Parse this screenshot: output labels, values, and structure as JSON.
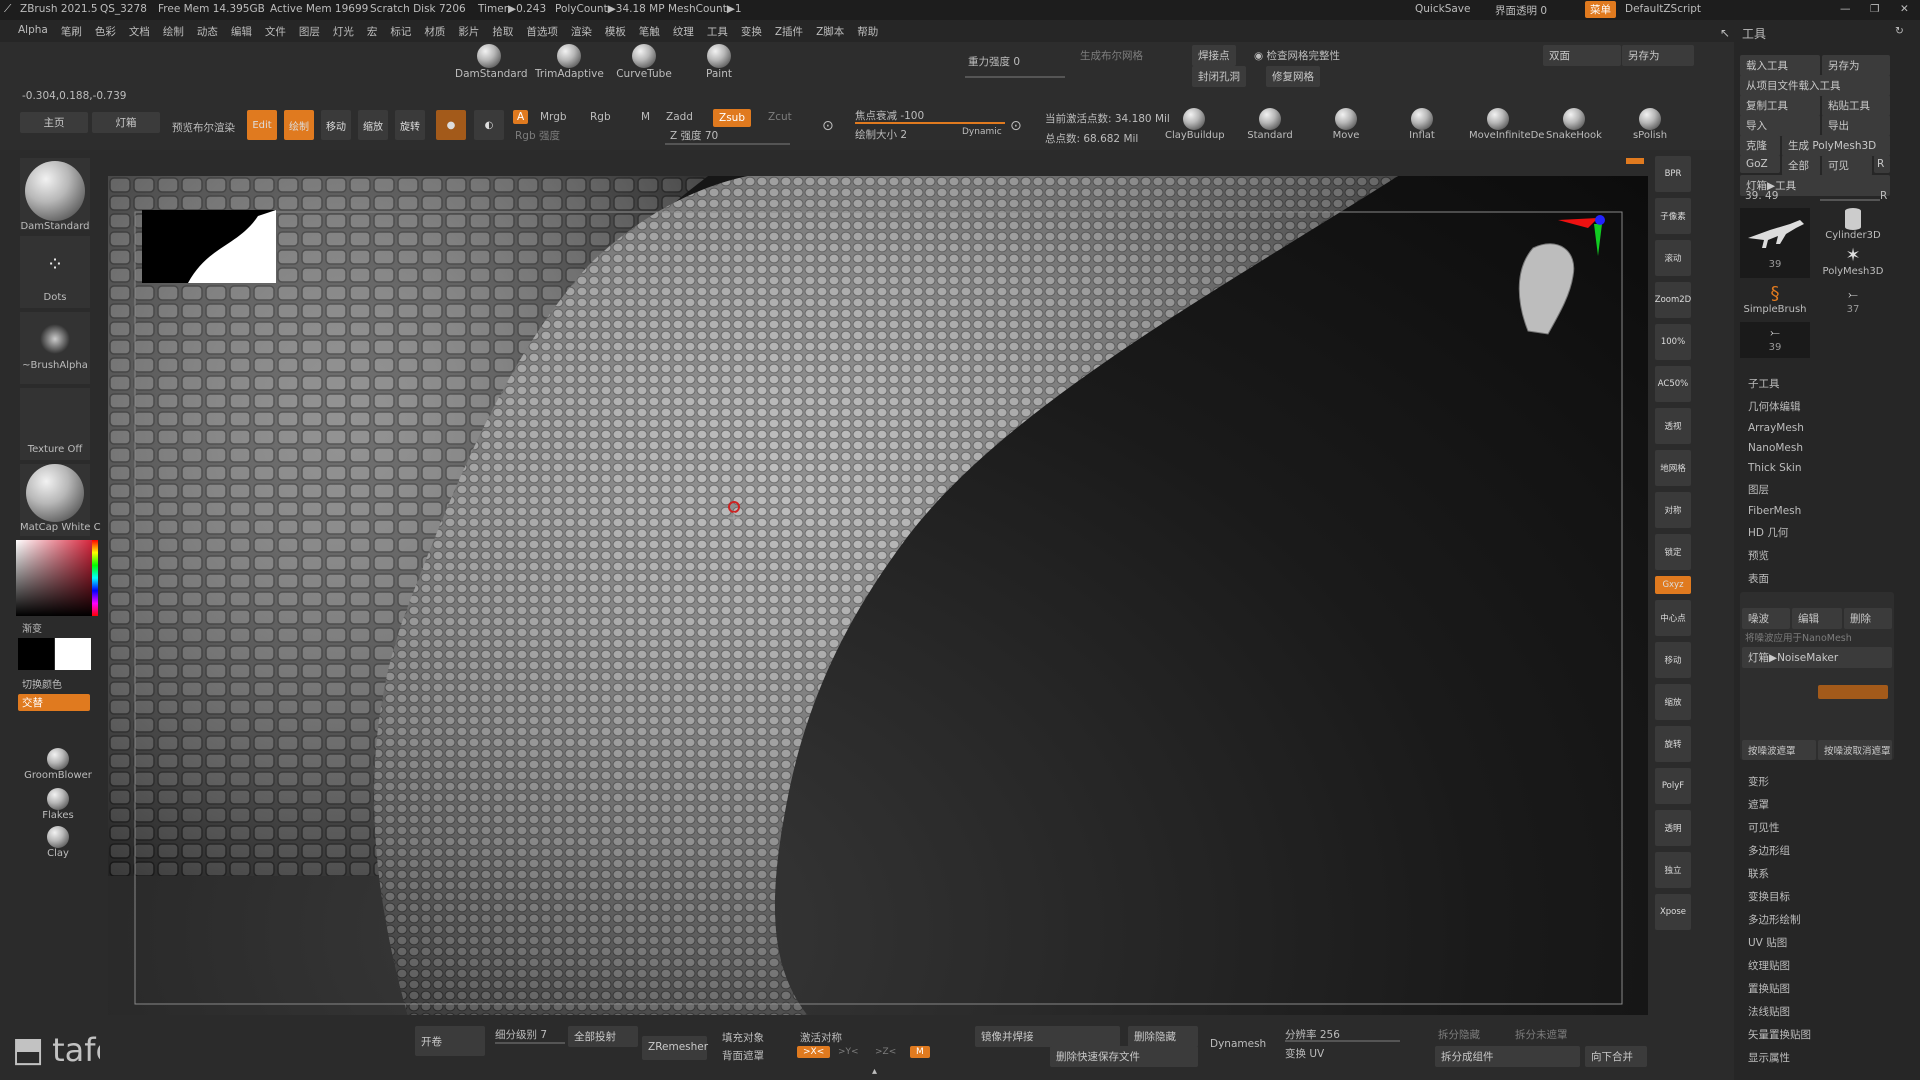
{
  "titlebar": {
    "app": "ZBrush 2021.5",
    "project": "QS_3278",
    "free_mem": "Free Mem 14.395GB",
    "active_mem": "Active Mem 19699",
    "scratch": "Scratch Disk 7206",
    "timer": "Timer▶0.243",
    "polycount": "PolyCount▶34.18 MP",
    "meshcount": "MeshCount▶1",
    "quicksave": "QuickSave",
    "transparency": "界面透明 0",
    "menu": "菜单",
    "script": "DefaultZScript"
  },
  "menubar": {
    "items": [
      "Alpha",
      "笔刷",
      "色彩",
      "文档",
      "绘制",
      "动态",
      "编辑",
      "文件",
      "图层",
      "灯光",
      "宏",
      "标记",
      "材质",
      "影片",
      "拾取",
      "首选项",
      "渲染",
      "模板",
      "笔触",
      "纹理",
      "工具",
      "变换",
      "Z插件",
      "Z脚本",
      "帮助"
    ]
  },
  "top": {
    "coords": "-0.304,0.188,-0.739",
    "home": "主页",
    "lightbox": "灯箱",
    "bpr": "预览布尔渲染",
    "brushes": [
      "DamStandard",
      "TrimAdaptive",
      "CurveTube",
      "Paint"
    ],
    "gravity": "重力强度 0",
    "weld": "焊接点",
    "check_mesh": "检查网格完整性",
    "close_holes": "封闭孔洞",
    "fix_mesh": "修复网格",
    "double": "双面",
    "save_as": "另存为",
    "gen_mesh": "生成布尔网格",
    "edit": "Edit",
    "draw": "绘制",
    "move": "移动",
    "scale": "缩放",
    "rotate": "旋转",
    "a_label": "A",
    "mrgb": "Mrgb",
    "rgb": "Rgb",
    "m": "M",
    "zadd": "Zadd",
    "zsub": "Zsub",
    "zcut": "Zcut",
    "rgb_intensity": "Rgb 强度",
    "z_intensity": "Z 强度 70",
    "focal": "焦点衰减 -100",
    "draw_size": "绘制大小 2",
    "dynamic": "Dynamic",
    "active_points": "当前激活点数: 34.180 Mil",
    "total_points": "总点数: 68.682 Mil",
    "brushes_right": [
      "ClayBuildup",
      "Standard",
      "Move",
      "Inflat",
      "MoveInfiniteDe",
      "SnakeHook",
      "sPolish"
    ]
  },
  "left": {
    "brush": "DamStandard",
    "stroke": "Dots",
    "alpha": "~BrushAlpha",
    "texture": "Texture Off",
    "material": "MatCap White C",
    "gradient": "渐变",
    "switch_color": "切换颜色",
    "alternate": "交替",
    "extra_brushes": [
      "GroomBlower",
      "Flakes",
      "Clay"
    ]
  },
  "shelf": [
    "BPR",
    "子像素",
    "滚动",
    "Zoom2D",
    "100%",
    "AC50%",
    "透视",
    "地网格",
    "对称",
    "锁定",
    "Gxyz",
    "中心点",
    "移动",
    "缩放",
    "旋转",
    "PolyF",
    "透明",
    "独立",
    "Xpose"
  ],
  "rightpanel": {
    "title": "工具",
    "load_tool": "载入工具",
    "save_as": "另存为",
    "load_from_project": "从项目文件载入工具",
    "copy_tool": "复制工具",
    "paste_tool": "粘贴工具",
    "import": "导入",
    "export": "导出",
    "clone": "克隆",
    "make_polymesh": "生成 PolyMesh3D",
    "goz": "GoZ",
    "all": "全部",
    "visible": "可见",
    "r": "R",
    "lightbox_tool": "灯箱▶工具",
    "tool_value": "39. 49",
    "thumbs": [
      {
        "label": "",
        "count": "39"
      },
      {
        "label": "Cylinder3D",
        "count": ""
      },
      {
        "label": "",
        "count": ""
      },
      {
        "label": "PolyMesh3D",
        "count": ""
      },
      {
        "label": "SimpleBrush",
        "count": ""
      },
      {
        "label": "",
        "count": "37"
      },
      {
        "label": "",
        "count": "39"
      }
    ],
    "sections": [
      "子工具",
      "几何体编辑",
      "ArrayMesh",
      "NanoMesh",
      "Thick Skin",
      "图层",
      "FiberMesh",
      "HD 几何",
      "预览",
      "表面"
    ],
    "surface": {
      "noise": "噪波",
      "edit": "编辑",
      "delete": "删除",
      "apply_nano": "将噪波应用于NanoMesh",
      "noisemaker": "灯箱▶NoiseMaker",
      "mask_by": "按噪波遮罩",
      "unmask_by": "按噪波取消遮罩"
    },
    "sections2": [
      "变形",
      "遮罩",
      "可见性",
      "多边形组",
      "联系",
      "变换目标",
      "多边形绘制",
      "UV 贴图",
      "纹理贴图",
      "置换贴图",
      "法线贴图",
      "矢量置换贴图",
      "显示属性"
    ]
  },
  "bottom": {
    "rollout": "开卷",
    "sdiv": "细分级别 7",
    "project_all": "全部投射",
    "zremesher": "ZRemesher",
    "fill_object": "填充对象",
    "activate_sym": "激活对称",
    "back_mask": "背面遮罩",
    "mirror_weld": "镜像并焊接",
    "del_hidden": "删除隐藏",
    "del_quicksave": "删除快速保存文件",
    "dynamesh": "Dynamesh",
    "resolution": "分辨率 256",
    "uv_switch": "变换 UV",
    "split_hidden": "拆分隐藏",
    "split_unmasked": "拆分未遮罩",
    "split_groups": "拆分成组件",
    "merge_down": "向下合并",
    "x": "&gt;X&lt;",
    "y": "&gt;Y&lt;",
    "z": "&gt;Z&lt;",
    "m": "M"
  },
  "watermark": "tafe.cc",
  "accent": "#e07a1f"
}
